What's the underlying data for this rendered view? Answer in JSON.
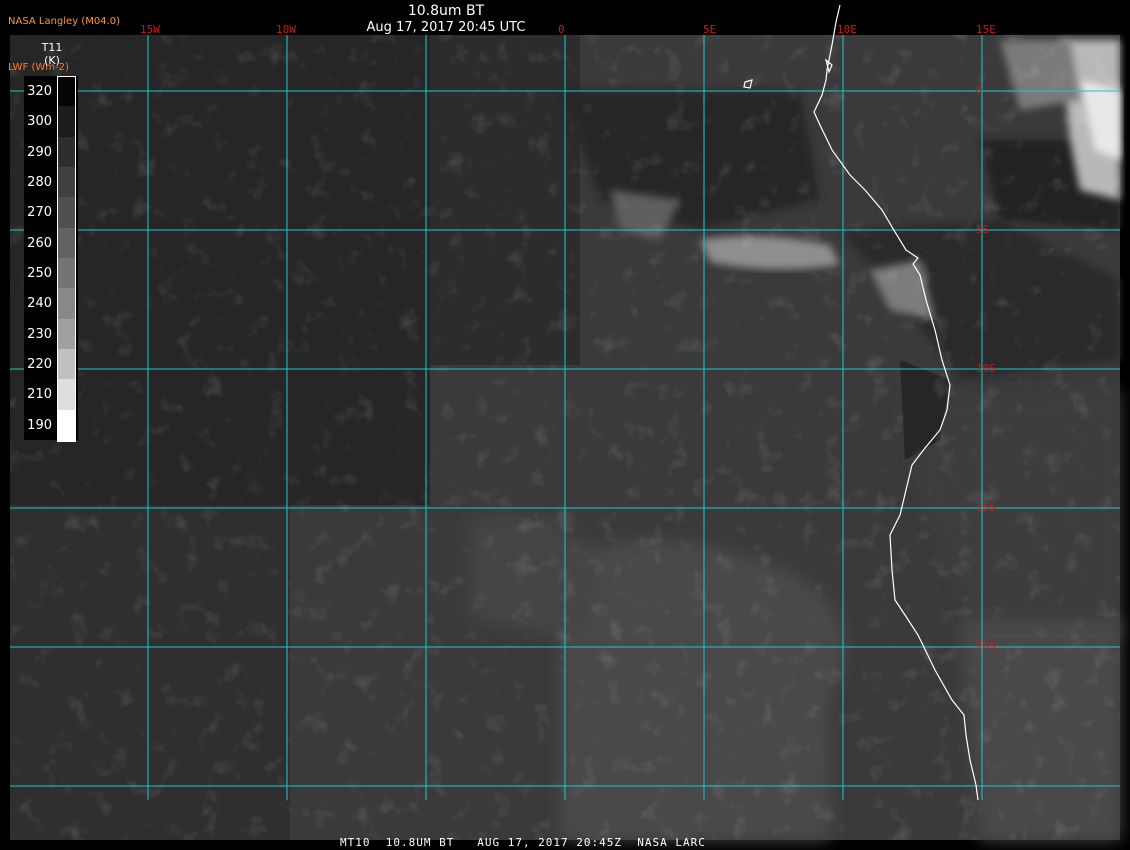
{
  "header": {
    "title": "10.8um BT",
    "datetime": "Aug 17, 2017 20:45 UTC",
    "credit": "NASA Langley (M04.0)",
    "overlay_label": "LWF (Wm-2)"
  },
  "legend": {
    "variable": "T11",
    "unit": "(K)",
    "values": [
      "320",
      "300",
      "290",
      "280",
      "270",
      "260",
      "250",
      "240",
      "230",
      "220",
      "210",
      "190"
    ],
    "colors": [
      "#050505",
      "#1c1c1c",
      "#2e2e2e",
      "#404040",
      "#505050",
      "#626262",
      "#747474",
      "#888888",
      "#a0a0a0",
      "#c0c0c0",
      "#dedede",
      "#ffffff"
    ]
  },
  "longitudes": [
    "15W",
    "10W",
    "0",
    "5E",
    "10E",
    "15E"
  ],
  "latitudes": [
    "0",
    "5S",
    "10S",
    "15S",
    "20S"
  ],
  "footer": "MT10  10.8UM BT   AUG 17, 2017 20:45Z  NASA LARC",
  "colors": {
    "grid": "#1ec8c8",
    "grid_label": "#d01818",
    "credit": "#ff9a2a",
    "coast": "#ffffff"
  }
}
